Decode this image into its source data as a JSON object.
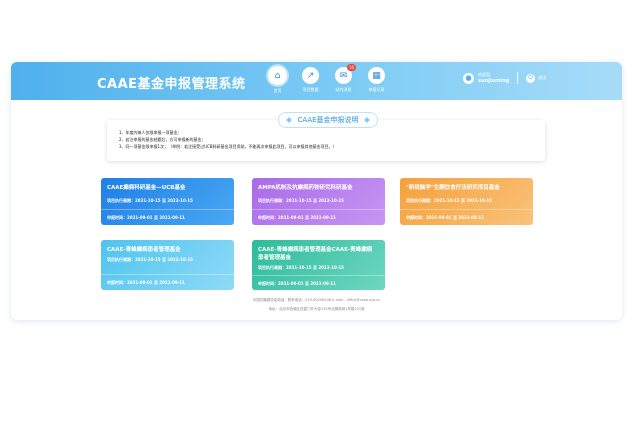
{
  "header": {
    "title": "CAAE基金申报管理系统",
    "nav": [
      {
        "label": "首页",
        "icon": "home-icon",
        "glyph": "⌂",
        "active": true
      },
      {
        "label": "项目数据",
        "icon": "chart-line-icon",
        "glyph": "↗",
        "active": false
      },
      {
        "label": "站内消息",
        "icon": "mail-icon",
        "glyph": "✉",
        "active": false,
        "badge": "10"
      },
      {
        "label": "申报记录",
        "icon": "record-icon",
        "glyph": "▦",
        "active": false
      }
    ],
    "user": {
      "welcome": "欢迎您,",
      "name": "sunjiuming"
    },
    "logout": "退出"
  },
  "notice": {
    "title": "CAAE基金申报说明",
    "lines": [
      "1、年度内每人仅限申报一项基金;",
      "2、若注申报的基金结题后，方可申报新的基金;",
      "3、同一项基金限申报1次；（举例：若注接受过UCB科研基金项目资助，不能再次申报此项目，可以申报其他基金项目。）"
    ]
  },
  "cards": [
    {
      "title": "CAAE癫痫科研基金—UCB基金",
      "exec_label": "项目执行周期：",
      "exec_range": "2021-10-15 至 2023-10-15",
      "apply_label": "申报时间：",
      "apply_range": "2021-09-01 至 2021-09-11",
      "color_start": "#1f7fe6",
      "color_end": "#4aa8f3"
    },
    {
      "title": "AMPA机制及抗癫痫药物研究科研基金",
      "exec_label": "项目执行周期：",
      "exec_range": "2021-10-15 至 2023-10-15",
      "apply_label": "申报时间：",
      "apply_range": "2021-09-01 至 2021-09-11",
      "color_start": "#a86be8",
      "color_end": "#c796f3"
    },
    {
      "title": "\"新锐脑学\"生酮饮食疗法研究项目基金",
      "exec_label": "项目执行周期：",
      "exec_range": "2021-10-15 至 2023-10-15",
      "apply_label": "申报时间：",
      "apply_range": "2021-09-01 至 2021-09-11",
      "color_start": "#f5a13c",
      "color_end": "#f9c27a"
    },
    {
      "title": "CAAE-青峰癫痫患者管理基金",
      "exec_label": "项目执行周期：",
      "exec_range": "2021-10-15 至 2023-10-15",
      "apply_label": "申报时间：",
      "apply_range": "2021-09-01 至 2021-09-11",
      "color_start": "#4fc4ef",
      "color_end": "#8fdaf7"
    },
    {
      "title": "CAAE-青峰癫痫患者管理基金CAAE-青峰癫痫患者管理基金",
      "exec_label": "项目执行周期：",
      "exec_range": "2021-10-15 至 2023-10-15",
      "apply_label": "申报时间：",
      "apply_range": "2021-09-01 至 2021-09-11",
      "color_start": "#2dbb9c",
      "color_end": "#6fd7c0"
    }
  ],
  "footer": {
    "line1": "中国抗癫痫协会电话：联系电话：010-60206548    E-mail：office@caae.org.cn",
    "line2": "地址：北京市西城区西直门外大街135号北展商城1号楼101室"
  }
}
